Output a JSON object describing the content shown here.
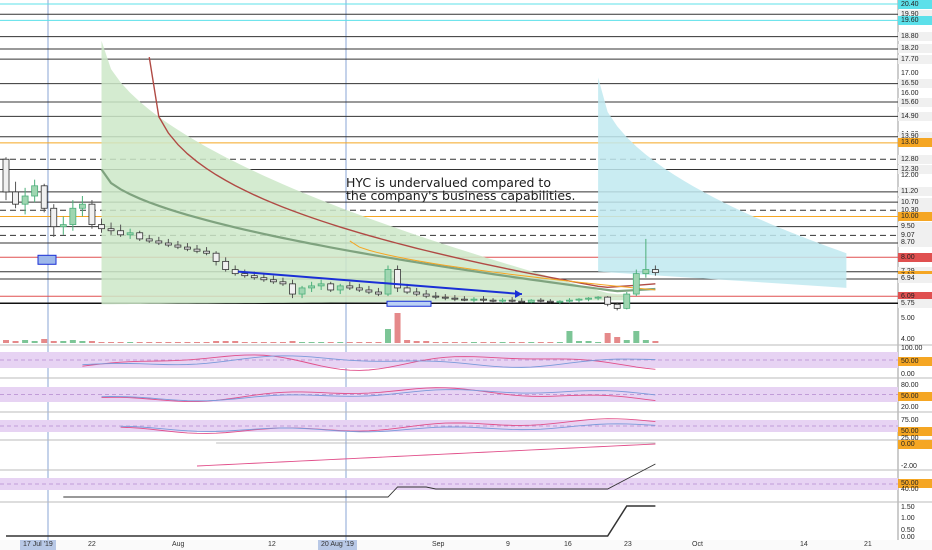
{
  "annotation": "HYC is undervalued compared to\nthe company's business capabilities.",
  "price_scale": {
    "labels": [
      {
        "v": "20.40",
        "c": "#5ce0ea"
      },
      {
        "v": "19.90",
        "c": "#f0f0f0"
      },
      {
        "v": "19.60",
        "c": "#5ce0ea"
      },
      {
        "v": "18.80",
        "c": "#f0f0f0"
      },
      {
        "v": "18.20",
        "c": "#f0f0f0"
      },
      {
        "v": "17.70",
        "c": "#f0f0f0"
      },
      {
        "v": "17.00",
        "c": ""
      },
      {
        "v": "16.50",
        "c": "#f0f0f0"
      },
      {
        "v": "16.00",
        "c": ""
      },
      {
        "v": "15.60",
        "c": "#f0f0f0"
      },
      {
        "v": "14.90",
        "c": "#f0f0f0"
      },
      {
        "v": "14.00",
        "c": ""
      },
      {
        "v": "13.90",
        "c": "#f0f0f0"
      },
      {
        "v": "13.60",
        "c": "#f5a623"
      },
      {
        "v": "12.80",
        "c": "#f0f0f0"
      },
      {
        "v": "12.30",
        "c": "#f0f0f0"
      },
      {
        "v": "12.00",
        "c": ""
      },
      {
        "v": "11.20",
        "c": "#f0f0f0"
      },
      {
        "v": "10.70",
        "c": "#f0f0f0"
      },
      {
        "v": "10.30",
        "c": "#f0f0f0"
      },
      {
        "v": "10.00",
        "c": "#f5a623"
      },
      {
        "v": "9.50",
        "c": "#f0f0f0"
      },
      {
        "v": "9.07",
        "c": "#f0f0f0"
      },
      {
        "v": "8.70",
        "c": "#f0f0f0"
      },
      {
        "v": "8.00",
        "c": "#e05050"
      },
      {
        "v": "7.29",
        "c": "#f0f0f0"
      },
      {
        "v": "7.12",
        "c": "#f5a623"
      },
      {
        "v": "6.94",
        "c": "#f0f0f0"
      },
      {
        "v": "6.09",
        "c": "#e05050"
      },
      {
        "v": "5.75",
        "c": "#f0f0f0"
      },
      {
        "v": "5.00",
        "c": ""
      },
      {
        "v": "4.00",
        "c": ""
      }
    ]
  },
  "indicator_scales": [
    {
      "labels": [
        {
          "v": "100.00",
          "c": ""
        },
        {
          "v": "50.00",
          "c": "#f5a623"
        },
        {
          "v": "0.00",
          "c": ""
        }
      ]
    },
    {
      "labels": [
        {
          "v": "80.00",
          "c": ""
        },
        {
          "v": "50.00",
          "c": "#f5a623"
        },
        {
          "v": "20.00",
          "c": ""
        }
      ]
    },
    {
      "labels": [
        {
          "v": "75.00",
          "c": ""
        },
        {
          "v": "50.00",
          "c": "#f5a623"
        },
        {
          "v": "25.00",
          "c": ""
        }
      ]
    },
    {
      "labels": [
        {
          "v": "0.00",
          "c": "#f5a623"
        },
        {
          "v": "-2.00",
          "c": ""
        }
      ]
    },
    {
      "labels": [
        {
          "v": "50.00",
          "c": "#f5a623"
        },
        {
          "v": "40.00",
          "c": ""
        }
      ]
    },
    {
      "labels": [
        {
          "v": "1.50",
          "c": ""
        },
        {
          "v": "1.00",
          "c": ""
        },
        {
          "v": "0.50",
          "c": ""
        },
        {
          "v": "0.00",
          "c": ""
        }
      ]
    }
  ],
  "time_axis": {
    "labels": [
      {
        "t": "17 Jul '19",
        "hl": true
      },
      {
        "t": "22",
        "hl": false
      },
      {
        "t": "Aug",
        "hl": false
      },
      {
        "t": "12",
        "hl": false
      },
      {
        "t": "20 Aug '19",
        "hl": true
      },
      {
        "t": "Sep",
        "hl": false
      },
      {
        "t": "9",
        "hl": false
      },
      {
        "t": "16",
        "hl": false
      },
      {
        "t": "23",
        "hl": false
      },
      {
        "t": "Oct",
        "hl": false
      },
      {
        "t": "14",
        "hl": false
      },
      {
        "t": "21",
        "hl": false
      }
    ]
  },
  "chart_data": {
    "type": "candlestick",
    "symbol": "HYC",
    "ylim": [
      4.0,
      20.4
    ],
    "horizontal_levels": [
      {
        "value": 20.4,
        "style": "solid",
        "color": "#5ce0ea"
      },
      {
        "value": 19.9,
        "style": "solid",
        "color": "#333333"
      },
      {
        "value": 19.6,
        "style": "solid",
        "color": "#5ce0ea"
      },
      {
        "value": 18.8,
        "style": "solid",
        "color": "#333333"
      },
      {
        "value": 18.2,
        "style": "solid",
        "color": "#333333"
      },
      {
        "value": 17.7,
        "style": "solid",
        "color": "#333333"
      },
      {
        "value": 16.5,
        "style": "solid",
        "color": "#333333"
      },
      {
        "value": 15.6,
        "style": "solid",
        "color": "#333333"
      },
      {
        "value": 14.9,
        "style": "solid",
        "color": "#333333"
      },
      {
        "value": 13.9,
        "style": "solid",
        "color": "#333333"
      },
      {
        "value": 13.6,
        "style": "solid",
        "color": "#f5a623"
      },
      {
        "value": 12.8,
        "style": "dashed",
        "color": "#333333"
      },
      {
        "value": 12.3,
        "style": "solid",
        "color": "#333333"
      },
      {
        "value": 11.2,
        "style": "solid",
        "color": "#333333"
      },
      {
        "value": 10.7,
        "style": "solid",
        "color": "#333333"
      },
      {
        "value": 10.3,
        "style": "dashed",
        "color": "#333333"
      },
      {
        "value": 10.0,
        "style": "solid",
        "color": "#f5a623"
      },
      {
        "value": 9.5,
        "style": "solid",
        "color": "#333333"
      },
      {
        "value": 9.07,
        "style": "dashed",
        "color": "#333333"
      },
      {
        "value": 8.7,
        "style": "solid",
        "color": "#333333"
      },
      {
        "value": 8.0,
        "style": "solid",
        "color": "#e05050"
      },
      {
        "value": 7.29,
        "style": "solid",
        "color": "#333333"
      },
      {
        "value": 6.94,
        "style": "solid",
        "color": "#333333"
      },
      {
        "value": 6.09,
        "style": "solid",
        "color": "#e05050"
      },
      {
        "value": 5.75,
        "style": "solid",
        "color": "#111111"
      }
    ],
    "candles": [
      [
        12.8,
        12.9,
        10.8,
        11.2
      ],
      [
        11.2,
        11.7,
        10.4,
        10.6
      ],
      [
        10.6,
        11.4,
        10.1,
        11.0
      ],
      [
        11.0,
        11.8,
        10.7,
        11.5
      ],
      [
        11.5,
        11.6,
        10.2,
        10.4
      ],
      [
        10.4,
        10.6,
        9.0,
        9.5
      ],
      [
        9.5,
        10.0,
        9.1,
        9.6
      ],
      [
        9.6,
        10.8,
        9.3,
        10.4
      ],
      [
        10.4,
        11.0,
        10.0,
        10.6
      ],
      [
        10.6,
        10.8,
        9.4,
        9.6
      ],
      [
        9.6,
        9.9,
        9.2,
        9.4
      ],
      [
        9.4,
        9.7,
        9.1,
        9.3
      ],
      [
        9.3,
        9.6,
        9.0,
        9.1
      ],
      [
        9.1,
        9.4,
        8.9,
        9.2
      ],
      [
        9.2,
        9.3,
        8.8,
        8.9
      ],
      [
        8.9,
        9.1,
        8.7,
        8.8
      ],
      [
        8.8,
        9.0,
        8.6,
        8.7
      ],
      [
        8.7,
        8.9,
        8.5,
        8.6
      ],
      [
        8.6,
        8.8,
        8.4,
        8.5
      ],
      [
        8.5,
        8.7,
        8.3,
        8.4
      ],
      [
        8.4,
        8.6,
        8.2,
        8.3
      ],
      [
        8.3,
        8.5,
        8.1,
        8.2
      ],
      [
        8.2,
        8.3,
        7.6,
        7.8
      ],
      [
        7.8,
        8.0,
        7.3,
        7.4
      ],
      [
        7.4,
        7.6,
        7.1,
        7.2
      ],
      [
        7.2,
        7.4,
        7.0,
        7.1
      ],
      [
        7.1,
        7.3,
        6.9,
        7.0
      ],
      [
        7.0,
        7.2,
        6.8,
        6.9
      ],
      [
        6.9,
        7.1,
        6.7,
        6.8
      ],
      [
        6.8,
        7.0,
        6.6,
        6.7
      ],
      [
        6.7,
        6.9,
        6.0,
        6.2
      ],
      [
        6.2,
        6.6,
        6.0,
        6.5
      ],
      [
        6.5,
        6.8,
        6.3,
        6.6
      ],
      [
        6.6,
        6.9,
        6.4,
        6.7
      ],
      [
        6.7,
        6.8,
        6.3,
        6.4
      ],
      [
        6.4,
        6.7,
        6.2,
        6.6
      ],
      [
        6.6,
        6.8,
        6.4,
        6.5
      ],
      [
        6.5,
        6.7,
        6.3,
        6.4
      ],
      [
        6.4,
        6.6,
        6.2,
        6.3
      ],
      [
        6.3,
        6.5,
        6.1,
        6.2
      ],
      [
        6.2,
        7.6,
        6.1,
        7.4
      ],
      [
        7.4,
        7.6,
        6.3,
        6.5
      ],
      [
        6.5,
        6.7,
        6.2,
        6.3
      ],
      [
        6.3,
        6.5,
        6.1,
        6.2
      ],
      [
        6.2,
        6.4,
        6.0,
        6.1
      ],
      [
        6.1,
        6.3,
        5.95,
        6.05
      ],
      [
        6.05,
        6.2,
        5.9,
        6.0
      ],
      [
        6.0,
        6.15,
        5.85,
        5.95
      ],
      [
        5.95,
        6.1,
        5.85,
        5.9
      ],
      [
        5.9,
        6.05,
        5.8,
        5.95
      ],
      [
        5.95,
        6.1,
        5.8,
        5.9
      ],
      [
        5.9,
        6.0,
        5.8,
        5.85
      ],
      [
        5.85,
        6.0,
        5.75,
        5.9
      ],
      [
        5.9,
        6.05,
        5.8,
        5.85
      ],
      [
        5.85,
        6.0,
        5.75,
        5.8
      ],
      [
        5.8,
        5.95,
        5.75,
        5.9
      ],
      [
        5.9,
        6.0,
        5.8,
        5.85
      ],
      [
        5.85,
        5.95,
        5.75,
        5.8
      ],
      [
        5.8,
        5.9,
        5.7,
        5.85
      ],
      [
        5.85,
        6.0,
        5.75,
        5.9
      ],
      [
        5.9,
        6.0,
        5.8,
        5.95
      ],
      [
        5.95,
        6.05,
        5.85,
        6.0
      ],
      [
        6.0,
        6.1,
        5.9,
        6.05
      ],
      [
        6.05,
        6.1,
        5.6,
        5.7
      ],
      [
        5.7,
        5.8,
        5.4,
        5.5
      ],
      [
        5.5,
        6.3,
        5.45,
        6.2
      ],
      [
        6.2,
        7.4,
        6.1,
        7.2
      ],
      [
        7.2,
        8.9,
        7.0,
        7.4
      ],
      [
        7.4,
        7.6,
        7.1,
        7.25
      ]
    ],
    "volume": [
      3,
      2,
      3,
      2,
      4,
      2,
      2,
      3,
      2,
      2,
      1,
      1,
      1,
      1,
      1,
      1,
      1,
      1,
      1,
      1,
      1,
      1,
      2,
      2,
      2,
      1,
      1,
      1,
      1,
      1,
      2,
      1,
      1,
      1,
      1,
      1,
      1,
      1,
      1,
      1,
      14,
      30,
      3,
      2,
      2,
      1,
      1,
      1,
      1,
      1,
      1,
      1,
      1,
      1,
      1,
      1,
      1,
      1,
      1,
      12,
      2,
      2,
      1,
      10,
      6,
      3,
      12,
      3,
      2
    ]
  }
}
